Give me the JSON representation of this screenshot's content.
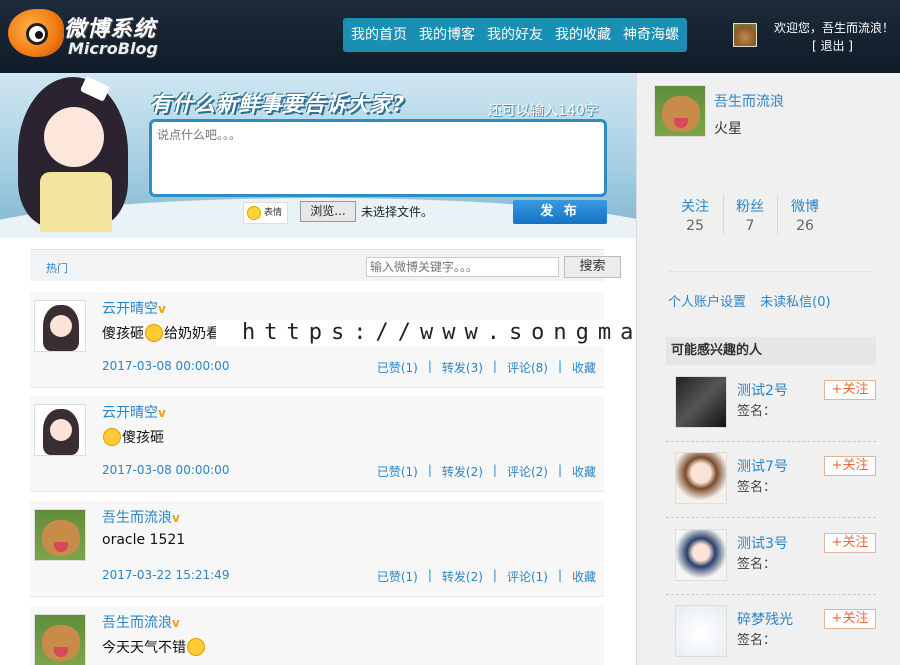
{
  "header": {
    "logo_cn": "微博系统",
    "logo_en": "MicroBlog",
    "nav": [
      "我的首页",
      "我的博客",
      "我的好友",
      "我的收藏",
      "神奇海螺"
    ],
    "welcome": "欢迎您，吾生而流浪！",
    "logout": "[ 退出 ]"
  },
  "composer": {
    "title": "有什么新鲜事要告诉大家?",
    "remaining": "还可以输入140字",
    "placeholder": "说点什么吧。。。",
    "emoji_label": "表情",
    "browse_label": "浏览...",
    "file_label": "未选择文件。",
    "publish_label": "发 布"
  },
  "toolbar": {
    "hot_tab": "热门",
    "search_placeholder": "输入微博关键字。。。",
    "search_button": "搜索"
  },
  "posts": [
    {
      "name": "云开晴空",
      "text": "傻孩砸",
      "text2": "给奶奶看",
      "time": "2017-03-08 00:00:00",
      "liked": "已赞(1)",
      "repost": "转发(3)",
      "comment": "评论(8)",
      "fav": "收藏"
    },
    {
      "name": "云开晴空",
      "text": "傻孩砸",
      "text2": "",
      "time": "2017-03-08 00:00:00",
      "liked": "已赞(1)",
      "repost": "转发(2)",
      "comment": "评论(2)",
      "fav": "收藏"
    },
    {
      "name": "吾生而流浪",
      "text": "oracle 1521",
      "text2": "",
      "time": "2017-03-22 15:21:49",
      "liked": "已赞(1)",
      "repost": "转发(2)",
      "comment": "评论(1)",
      "fav": "收藏"
    },
    {
      "name": "吾生而流浪",
      "text": "今天天气不错",
      "text2": "",
      "time": "",
      "liked": "",
      "repost": "",
      "comment": "",
      "fav": ""
    }
  ],
  "vip_mark": "v",
  "watermark": "https://www.songma.com",
  "profile": {
    "name": "吾生而流浪",
    "location": "火星",
    "stats": [
      {
        "label": "关注",
        "value": "25"
      },
      {
        "label": "粉丝",
        "value": "7"
      },
      {
        "label": "微博",
        "value": "26"
      }
    ],
    "links": [
      "个人账户设置",
      "未读私信(0)"
    ]
  },
  "suggestions": {
    "title": "可能感兴趣的人",
    "follow_label": "+关注",
    "sign_label": "签名：",
    "users": [
      {
        "name": "测试2号"
      },
      {
        "name": "测试7号"
      },
      {
        "name": "测试3号"
      },
      {
        "name": "碎梦残光"
      }
    ]
  }
}
